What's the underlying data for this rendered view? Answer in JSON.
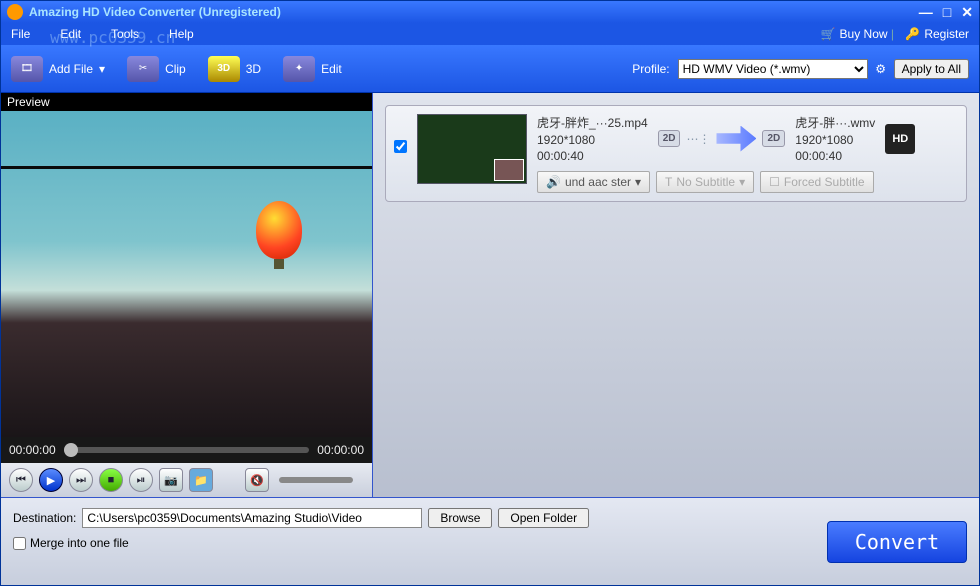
{
  "window": {
    "title": "Amazing HD Video Converter (Unregistered)"
  },
  "menu": {
    "file": "File",
    "edit": "Edit",
    "tools": "Tools",
    "help": "Help",
    "buy": "Buy Now",
    "register": "Register"
  },
  "toolbar": {
    "addfile": "Add File",
    "clip": "Clip",
    "threed": "3D",
    "edit": "Edit",
    "profile_label": "Profile:",
    "profile_value": "HD WMV Video (*.wmv)",
    "apply_all": "Apply to All"
  },
  "preview": {
    "label": "Preview",
    "time_left": "00:00:00",
    "time_right": "00:00:00"
  },
  "file": {
    "src_name": "虎牙-胖炸_···25.mp4",
    "src_res": "1920*1080",
    "src_dur": "00:00:40",
    "dst_name": "虎牙-胖···.wmv",
    "dst_res": "1920*1080",
    "dst_dur": "00:00:40",
    "badge2d": "2D",
    "hd": "HD",
    "audio": "und aac ster",
    "nosub": "No Subtitle",
    "forced": "Forced Subtitle"
  },
  "bottom": {
    "dest_label": "Destination:",
    "dest_path": "C:\\Users\\pc0359\\Documents\\Amazing Studio\\Video",
    "browse": "Browse",
    "open_folder": "Open Folder",
    "merge": "Merge into one file",
    "convert": "Convert"
  },
  "watermark": "www.pc0359.cn"
}
